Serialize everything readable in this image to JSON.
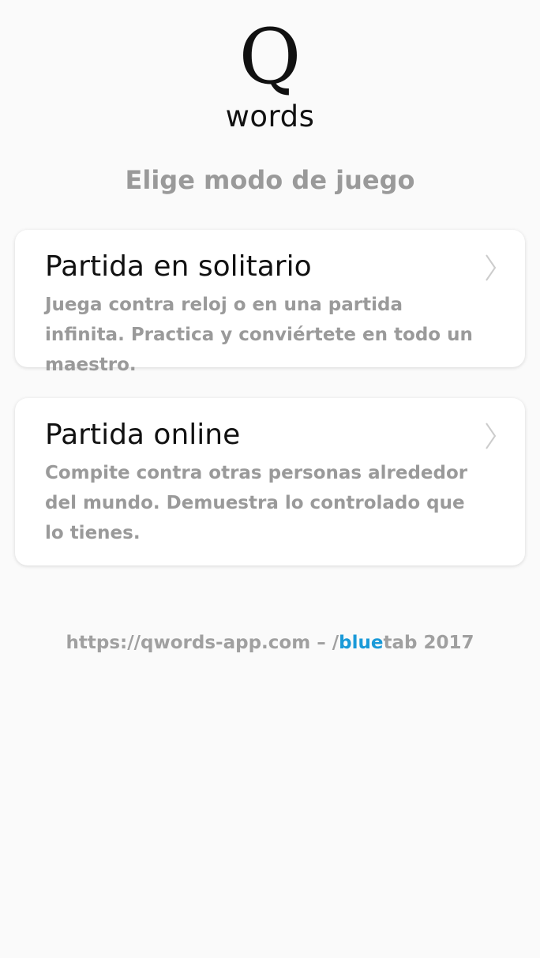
{
  "logo": {
    "letter": "Q",
    "word": "words"
  },
  "subtitle": "Elige modo de juego",
  "modes": [
    {
      "title": "Partida en solitario",
      "description": "Juega contra reloj o en una partida infinita. Practica y conviértete en todo un maestro."
    },
    {
      "title": "Partida online",
      "description": "Compite contra otras personas alrededor del mundo. Demuestra lo controlado que lo tienes."
    }
  ],
  "footer": {
    "url": "https://qwords-app.com",
    "separator": " – /",
    "brand_highlight": "blue",
    "brand_rest": "tab",
    "year": " 2017"
  },
  "icons": {
    "chevron": "chevron-right-icon"
  },
  "colors": {
    "background": "#fafafa",
    "card": "#ffffff",
    "muted_text": "#9a9a9a",
    "brand_blue": "#1a9ad8",
    "chevron": "#cccccc"
  }
}
